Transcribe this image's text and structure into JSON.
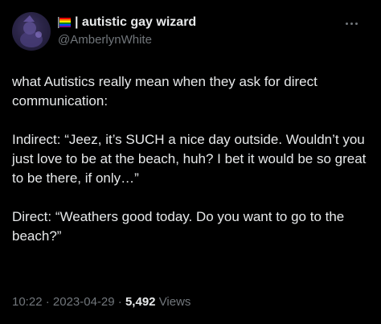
{
  "author": {
    "display_name": "| autistic gay wizard",
    "handle": "@AmberlynWhite",
    "flag_icon": "rainbow-flag-emoji"
  },
  "post": {
    "paragraphs": [
      "what Autistics really mean when they ask for direct communication:",
      "Indirect: “Jeez, it’s SUCH a nice day outside. Wouldn’t you just love to be at the beach, huh? I bet it would be so great to be there, if only…”",
      "Direct: “Weathers good today. Do you want to go to the beach?”"
    ]
  },
  "meta": {
    "time": "10:22",
    "separator": "·",
    "date": "2023-04-29",
    "views_count": "5,492",
    "views_label": "Views"
  },
  "colors": {
    "background": "#000000",
    "primary_text": "#e7e9ea",
    "secondary_text": "#71767b"
  }
}
